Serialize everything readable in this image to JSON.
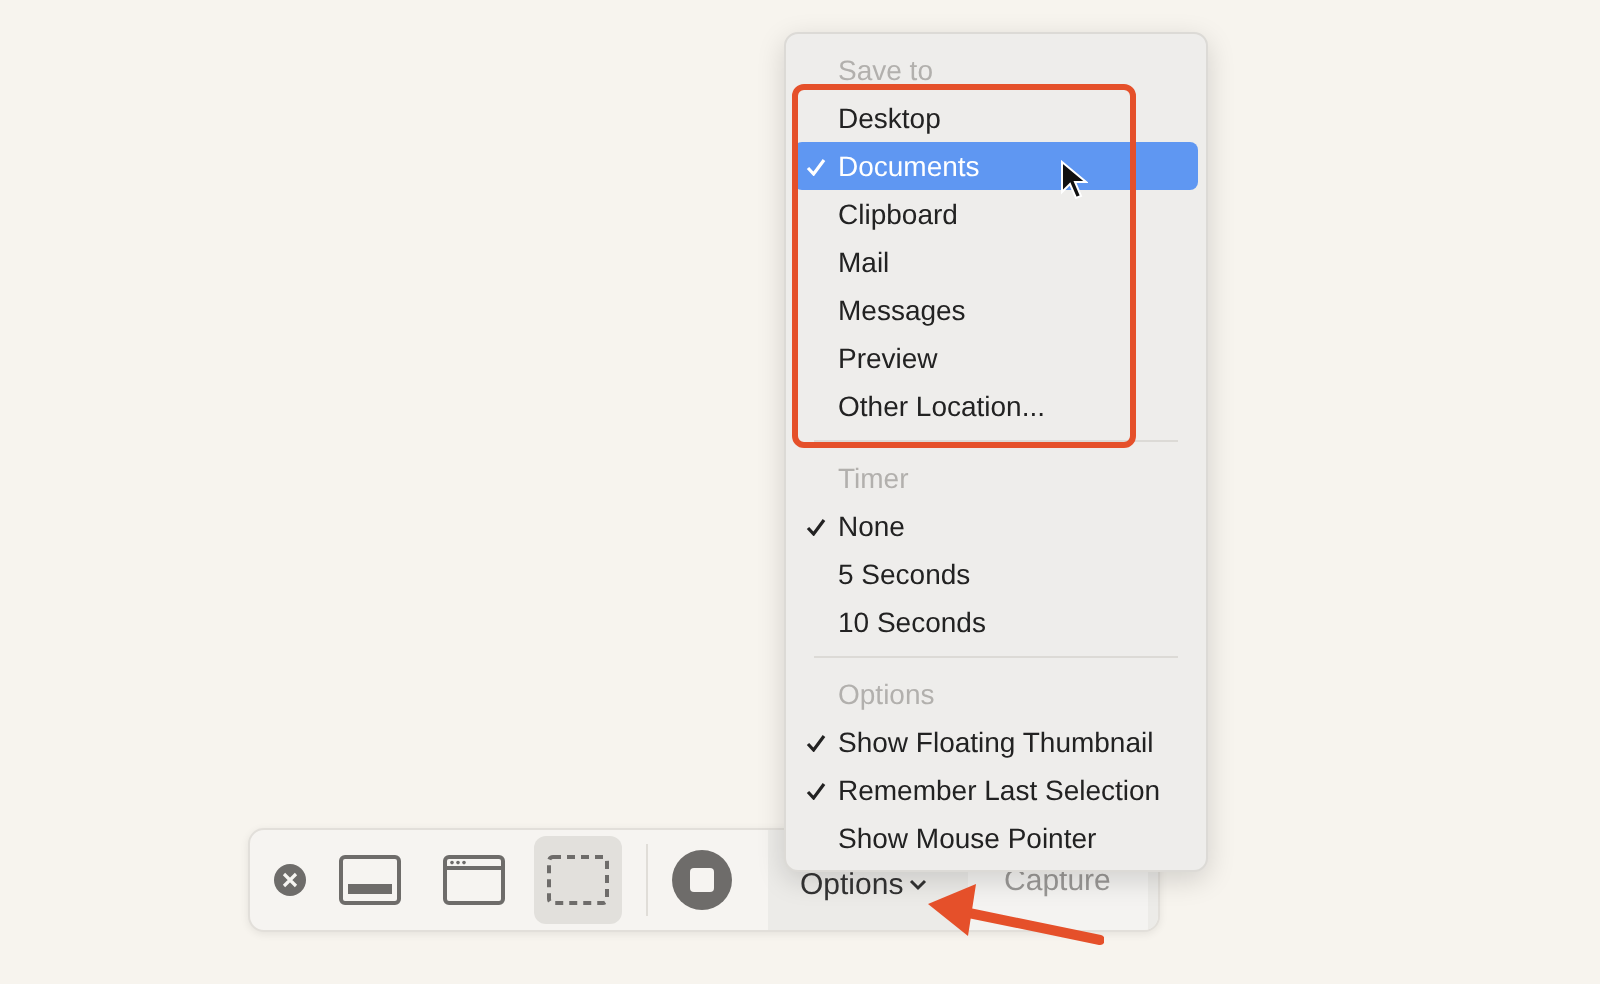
{
  "toolbar": {
    "capture_modes": [
      {
        "kind": "screen",
        "selected": false
      },
      {
        "kind": "window",
        "selected": false
      },
      {
        "kind": "selection",
        "selected": true
      }
    ],
    "options_button": {
      "label": "Options"
    },
    "capture_button": {
      "label": "Capture",
      "disabled": true
    }
  },
  "menu": {
    "sections": [
      {
        "header": "Save to",
        "items": [
          {
            "label": "Desktop",
            "checked": false,
            "selected": false
          },
          {
            "label": "Documents",
            "checked": true,
            "selected": true
          },
          {
            "label": "Clipboard",
            "checked": false,
            "selected": false
          },
          {
            "label": "Mail",
            "checked": false,
            "selected": false
          },
          {
            "label": "Messages",
            "checked": false,
            "selected": false
          },
          {
            "label": "Preview",
            "checked": false,
            "selected": false
          },
          {
            "label": "Other Location...",
            "checked": false,
            "selected": false
          }
        ]
      },
      {
        "header": "Timer",
        "items": [
          {
            "label": "None",
            "checked": true,
            "selected": false
          },
          {
            "label": "5 Seconds",
            "checked": false,
            "selected": false
          },
          {
            "label": "10 Seconds",
            "checked": false,
            "selected": false
          }
        ]
      },
      {
        "header": "Options",
        "items": [
          {
            "label": "Show Floating Thumbnail",
            "checked": true,
            "selected": false
          },
          {
            "label": "Remember Last Selection",
            "checked": true,
            "selected": false
          },
          {
            "label": "Show Mouse Pointer",
            "checked": false,
            "selected": false
          }
        ]
      }
    ]
  }
}
